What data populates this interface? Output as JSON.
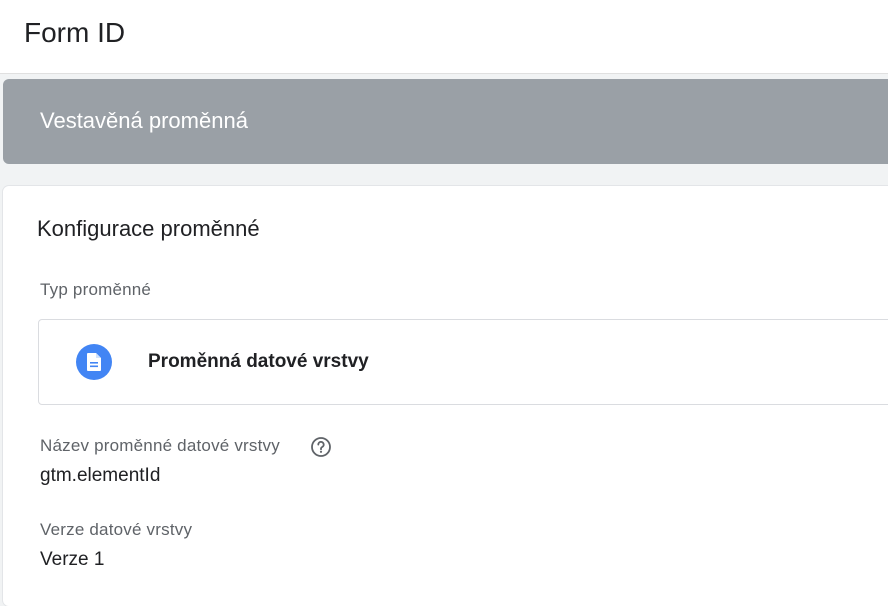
{
  "header": {
    "title": "Form ID"
  },
  "banner": {
    "text": "Vestavěná proměnná"
  },
  "config": {
    "title": "Konfigurace proměnné",
    "type_label": "Typ proměnné",
    "type_value": "Proměnná datové vrstvy",
    "type_icon": "document-icon",
    "variable_name_label": "Název proměnné datové vrstvy",
    "variable_name_value": "gtm.elementId",
    "help_icon": "help-icon",
    "version_label": "Verze datové vrstvy",
    "version_value": "Verze 1"
  },
  "colors": {
    "banner_bg": "#9aa0a6",
    "icon_bg": "#4285f4",
    "background": "#f1f3f4"
  }
}
